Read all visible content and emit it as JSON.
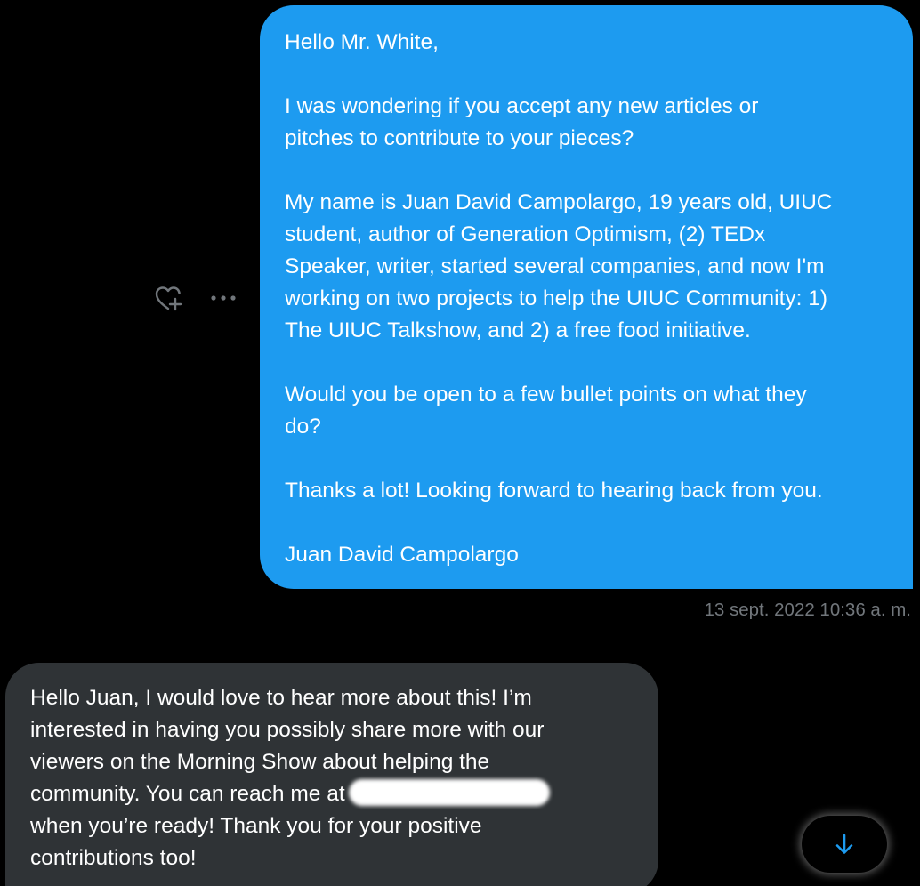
{
  "sent_message": {
    "paragraphs": [
      "Hello Mr. White,",
      "I was wondering if you accept any new articles or\npitches to contribute to your pieces?",
      "My name is Juan David Campolargo, 19 years old, UIUC\nstudent, author of Generation Optimism, (2) TEDx\nSpeaker, writer, started several companies, and now I'm\nworking on two projects to help the UIUC Community: 1)\nThe UIUC Talkshow, and 2) a free food initiative.",
      "Would you be open to a few bullet points on what they\ndo?",
      "Thanks a lot! Looking forward to hearing back from you.",
      "Juan David Campolargo"
    ],
    "timestamp": "13 sept. 2022 10:36 a. m.",
    "color": "#1d9bf0"
  },
  "message_actions": {
    "react_icon": "heart-plus-icon",
    "more_icon": "more-horizontal-icon"
  },
  "received_message": {
    "text_before_redaction": "Hello Juan, I would love to hear more about this! I’m\ninterested in having you possibly share more with our\nviewers on the Morning Show about helping the\ncommunity. You can reach me at ",
    "text_after_redaction": "\nwhen you’re ready! Thank you for your positive\ncontributions too!",
    "color": "#2f3336"
  },
  "scroll_down": {
    "icon": "arrow-down-icon",
    "accent": "#1d9bf0"
  }
}
